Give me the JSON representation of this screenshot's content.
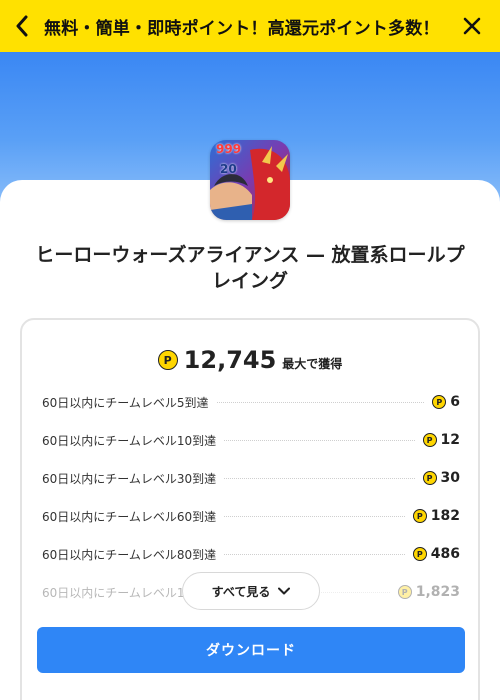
{
  "header": {
    "title": "無料・簡単・即時ポイント！高還元ポイント多数！"
  },
  "app": {
    "title_line1": "ヒーローウォーズアライアンス — 放置系ロールプ",
    "title_line2": "レイング",
    "icon_text_top": "999",
    "icon_text_mid": "20"
  },
  "rewards": {
    "coin_symbol": "P",
    "total": "12,745",
    "total_suffix": "最大で獲得",
    "items": [
      {
        "label": "60日以内にチームレベル5到達",
        "points": "6"
      },
      {
        "label": "60日以内にチームレベル10到達",
        "points": "12"
      },
      {
        "label": "60日以内にチームレベル30到達",
        "points": "30"
      },
      {
        "label": "60日以内にチームレベル60到達",
        "points": "182"
      },
      {
        "label": "60日以内にチームレベル80到達",
        "points": "486"
      },
      {
        "label": "60日以内にチームレベル1",
        "points": "1,823"
      }
    ],
    "see_all_label": "すべて見る"
  },
  "download_label": "ダウンロード",
  "colors": {
    "header_bg": "#ffe100",
    "accent_blue": "#2f86f6",
    "coin_yellow": "#ffd600"
  }
}
